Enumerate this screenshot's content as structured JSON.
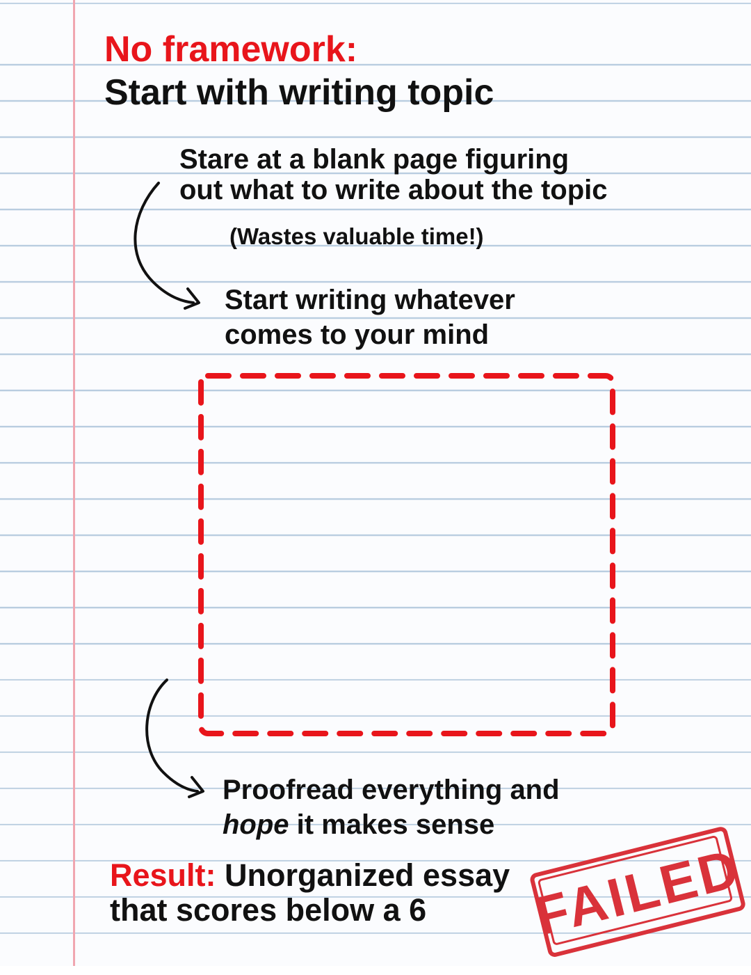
{
  "header": {
    "label": "No framework:",
    "title": "Start with writing topic"
  },
  "steps": {
    "step1_line1": "Stare at a blank page figuring",
    "step1_line2": "out what to write about the topic",
    "note": "(Wastes valuable time!)",
    "step2_line1": "Start writing whatever",
    "step2_line2": "comes to your mind",
    "step3_line1": "Proofread everything and",
    "step3_hope": "hope",
    "step3_line2_rest": " it makes sense"
  },
  "result": {
    "label": "Result:",
    "line1_rest": " Unorganized essay",
    "line2": "that scores below a 6"
  },
  "stamp": {
    "text": "FAILED"
  },
  "colors": {
    "accent_red": "#e8151b",
    "stamp_red": "#d9323a",
    "rule_blue": "#b9cde0",
    "margin_pink": "#f0a6b0"
  },
  "icons": [
    "curved-arrow-icon",
    "curved-arrow-icon"
  ]
}
